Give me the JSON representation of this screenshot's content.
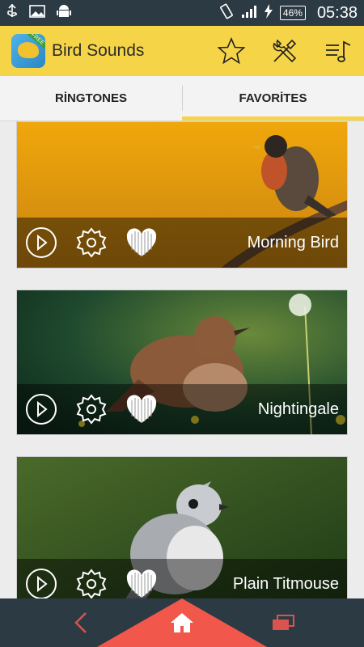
{
  "app": {
    "title": "Bird Sounds",
    "icon_badge": "FREE"
  },
  "status_bar": {
    "battery": "46%",
    "time": "05:38"
  },
  "tabs": [
    {
      "label": "RİNGTONES",
      "active": false
    },
    {
      "label": "FAVORİTES",
      "active": true
    }
  ],
  "cards": [
    {
      "title": "Morning Bird"
    },
    {
      "title": "Nightingale"
    },
    {
      "title": "Plain Titmouse"
    }
  ],
  "colors": {
    "accent": "#f6d447",
    "dark": "#2c3a44",
    "home": "#f1584b"
  }
}
